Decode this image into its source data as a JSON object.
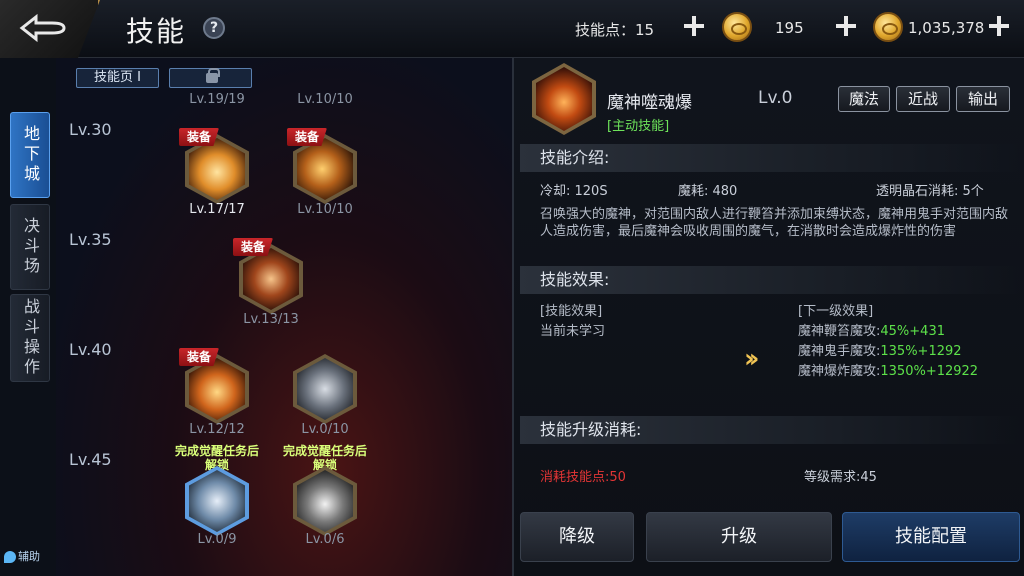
{
  "header": {
    "title": "技能",
    "help": "?",
    "skill_points_label": "技能点：15",
    "gold_coins": "195",
    "bound_gold": "1,035,378"
  },
  "sidebar": {
    "tabs": [
      {
        "label": "地下城",
        "active": true
      },
      {
        "label": "决斗场",
        "active": false
      },
      {
        "label": "战斗操作",
        "active": false
      }
    ],
    "assist": "辅助"
  },
  "tree": {
    "page_tab": "技能页 I",
    "levels": [
      "Lv.30",
      "Lv.35",
      "Lv.40",
      "Lv.45"
    ],
    "top_levels": [
      "Lv.19/19",
      "Lv.10/10"
    ],
    "equip_tag": "装备",
    "skills": [
      {
        "lv": "Lv.17/17",
        "equipped": true
      },
      {
        "lv": "Lv.10/10",
        "equipped": true
      },
      {
        "lv": "Lv.13/13",
        "equipped": true
      },
      {
        "lv": "Lv.12/12",
        "equipped": true
      },
      {
        "lv": "Lv.0/10",
        "equipped": false
      },
      {
        "lv": "Lv.0/9",
        "equipped": false,
        "note": "完成觉醒任务后解锁"
      },
      {
        "lv": "Lv.0/6",
        "equipped": false,
        "note": "完成觉醒任务后解锁"
      }
    ]
  },
  "detail": {
    "name": "魔神噬魂爆",
    "type": "[主动技能]",
    "level": "Lv.0",
    "tags": [
      "魔法",
      "近战",
      "输出"
    ],
    "intro_title": "技能介绍:",
    "cooldown": "冷却: 120S",
    "mana": "魔耗: 480",
    "crystal": "透明晶石消耗: 5个",
    "description": "召唤强大的魔神，对范围内敌人进行鞭笞并添加束缚状态，魔神用鬼手对范围内敌人造成伤害，最后魔神会吸收周围的魔气，在消散时会造成爆炸性的伤害",
    "effect_title": "技能效果:",
    "current_head": "[技能效果]",
    "current_text": "当前未学习",
    "next_head": "[下一级效果]",
    "next_effects": [
      {
        "label": "魔神鞭笞魔攻:",
        "value": "45%+431"
      },
      {
        "label": "魔神鬼手魔攻:",
        "value": "135%+1292"
      },
      {
        "label": "魔神爆炸魔攻:",
        "value": "1350%+12922"
      }
    ],
    "upgrade_title": "技能升级消耗:",
    "cost_points": "消耗技能点:50",
    "level_req": "等级需求:45",
    "buttons": {
      "downgrade": "降级",
      "upgrade": "升级",
      "config": "技能配置"
    }
  },
  "colors": {
    "accent_gold": "#b58c46",
    "active_tab": "#2f74c4",
    "green_text": "#5de24a",
    "red_text": "#e43535"
  }
}
